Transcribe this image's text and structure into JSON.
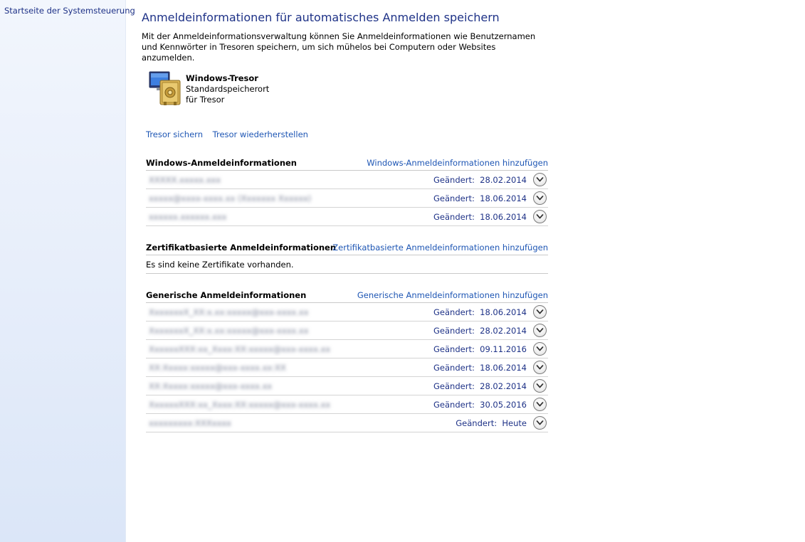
{
  "sidebar": {
    "home_link": "Startseite der Systemsteuerung"
  },
  "page": {
    "title": "Anmeldeinformationen für automatisches Anmelden speichern",
    "intro": "Mit der Anmeldeinformationsverwaltung können Sie Anmeldeinformationen wie Benutzernamen und Kennwörter in Tresoren speichern, um sich mühelos bei Computern oder Websites anzumelden."
  },
  "vault": {
    "icon": "vault-safe-icon",
    "name": "Windows-Tresor",
    "line1": "Standardspeicherort",
    "line2": "für Tresor",
    "backup_link": "Tresor sichern",
    "restore_link": "Tresor wiederherstellen"
  },
  "sections": {
    "windows": {
      "title": "Windows-Anmeldeinformationen",
      "add_link": "Windows-Anmeldeinformationen hinzufügen",
      "items": [
        {
          "name": "XXXXX.xxxxx.xxx",
          "changed_label": "Geändert:",
          "changed": "28.02.2014"
        },
        {
          "name": "xxxxx@xxxx-xxxx.xx (Xxxxxxx Xxxxxx)",
          "changed_label": "Geändert:",
          "changed": "18.06.2014"
        },
        {
          "name": "xxxxxx.xxxxxx.xxx",
          "changed_label": "Geändert:",
          "changed": "18.06.2014"
        }
      ]
    },
    "certificate": {
      "title": "Zertifikatbasierte Anmeldeinformationen",
      "add_link": "Zertifikatbasierte Anmeldeinformationen hinzufügen",
      "empty_text": "Es sind keine Zertifikate vorhanden."
    },
    "generic": {
      "title": "Generische Anmeldeinformationen",
      "add_link": "Generische Anmeldeinformationen hinzufügen",
      "items": [
        {
          "name": "XxxxxxxX_XX:x.xx:xxxxx@xxx-xxxx.xx",
          "changed_label": "Geändert:",
          "changed": "18.06.2014"
        },
        {
          "name": "XxxxxxxX_XX:x.xx:xxxxx@xxx-xxxx.xx",
          "changed_label": "Geändert:",
          "changed": "28.02.2014"
        },
        {
          "name": "XxxxxxXXX:xx_Xxxx:XX:xxxxx@xxx-xxxx.xx",
          "changed_label": "Geändert:",
          "changed": "09.11.2016"
        },
        {
          "name": "XX:Xxxxx:xxxxx@xxx-xxxx.xx:XX",
          "changed_label": "Geändert:",
          "changed": "18.06.2014"
        },
        {
          "name": "XX:Xxxxx:xxxxx@xxx-xxxx.xx",
          "changed_label": "Geändert:",
          "changed": "28.02.2014"
        },
        {
          "name": "XxxxxxXXX:xx_Xxxx:XX:xxxxx@xxx-xxxx.xx",
          "changed_label": "Geändert:",
          "changed": "30.05.2016"
        },
        {
          "name": "xxxxxxxxx:XXXxxxx",
          "changed_label": "Geändert:",
          "changed": "Heute"
        }
      ]
    }
  },
  "icons": {
    "expand": "chevron-down-icon"
  }
}
